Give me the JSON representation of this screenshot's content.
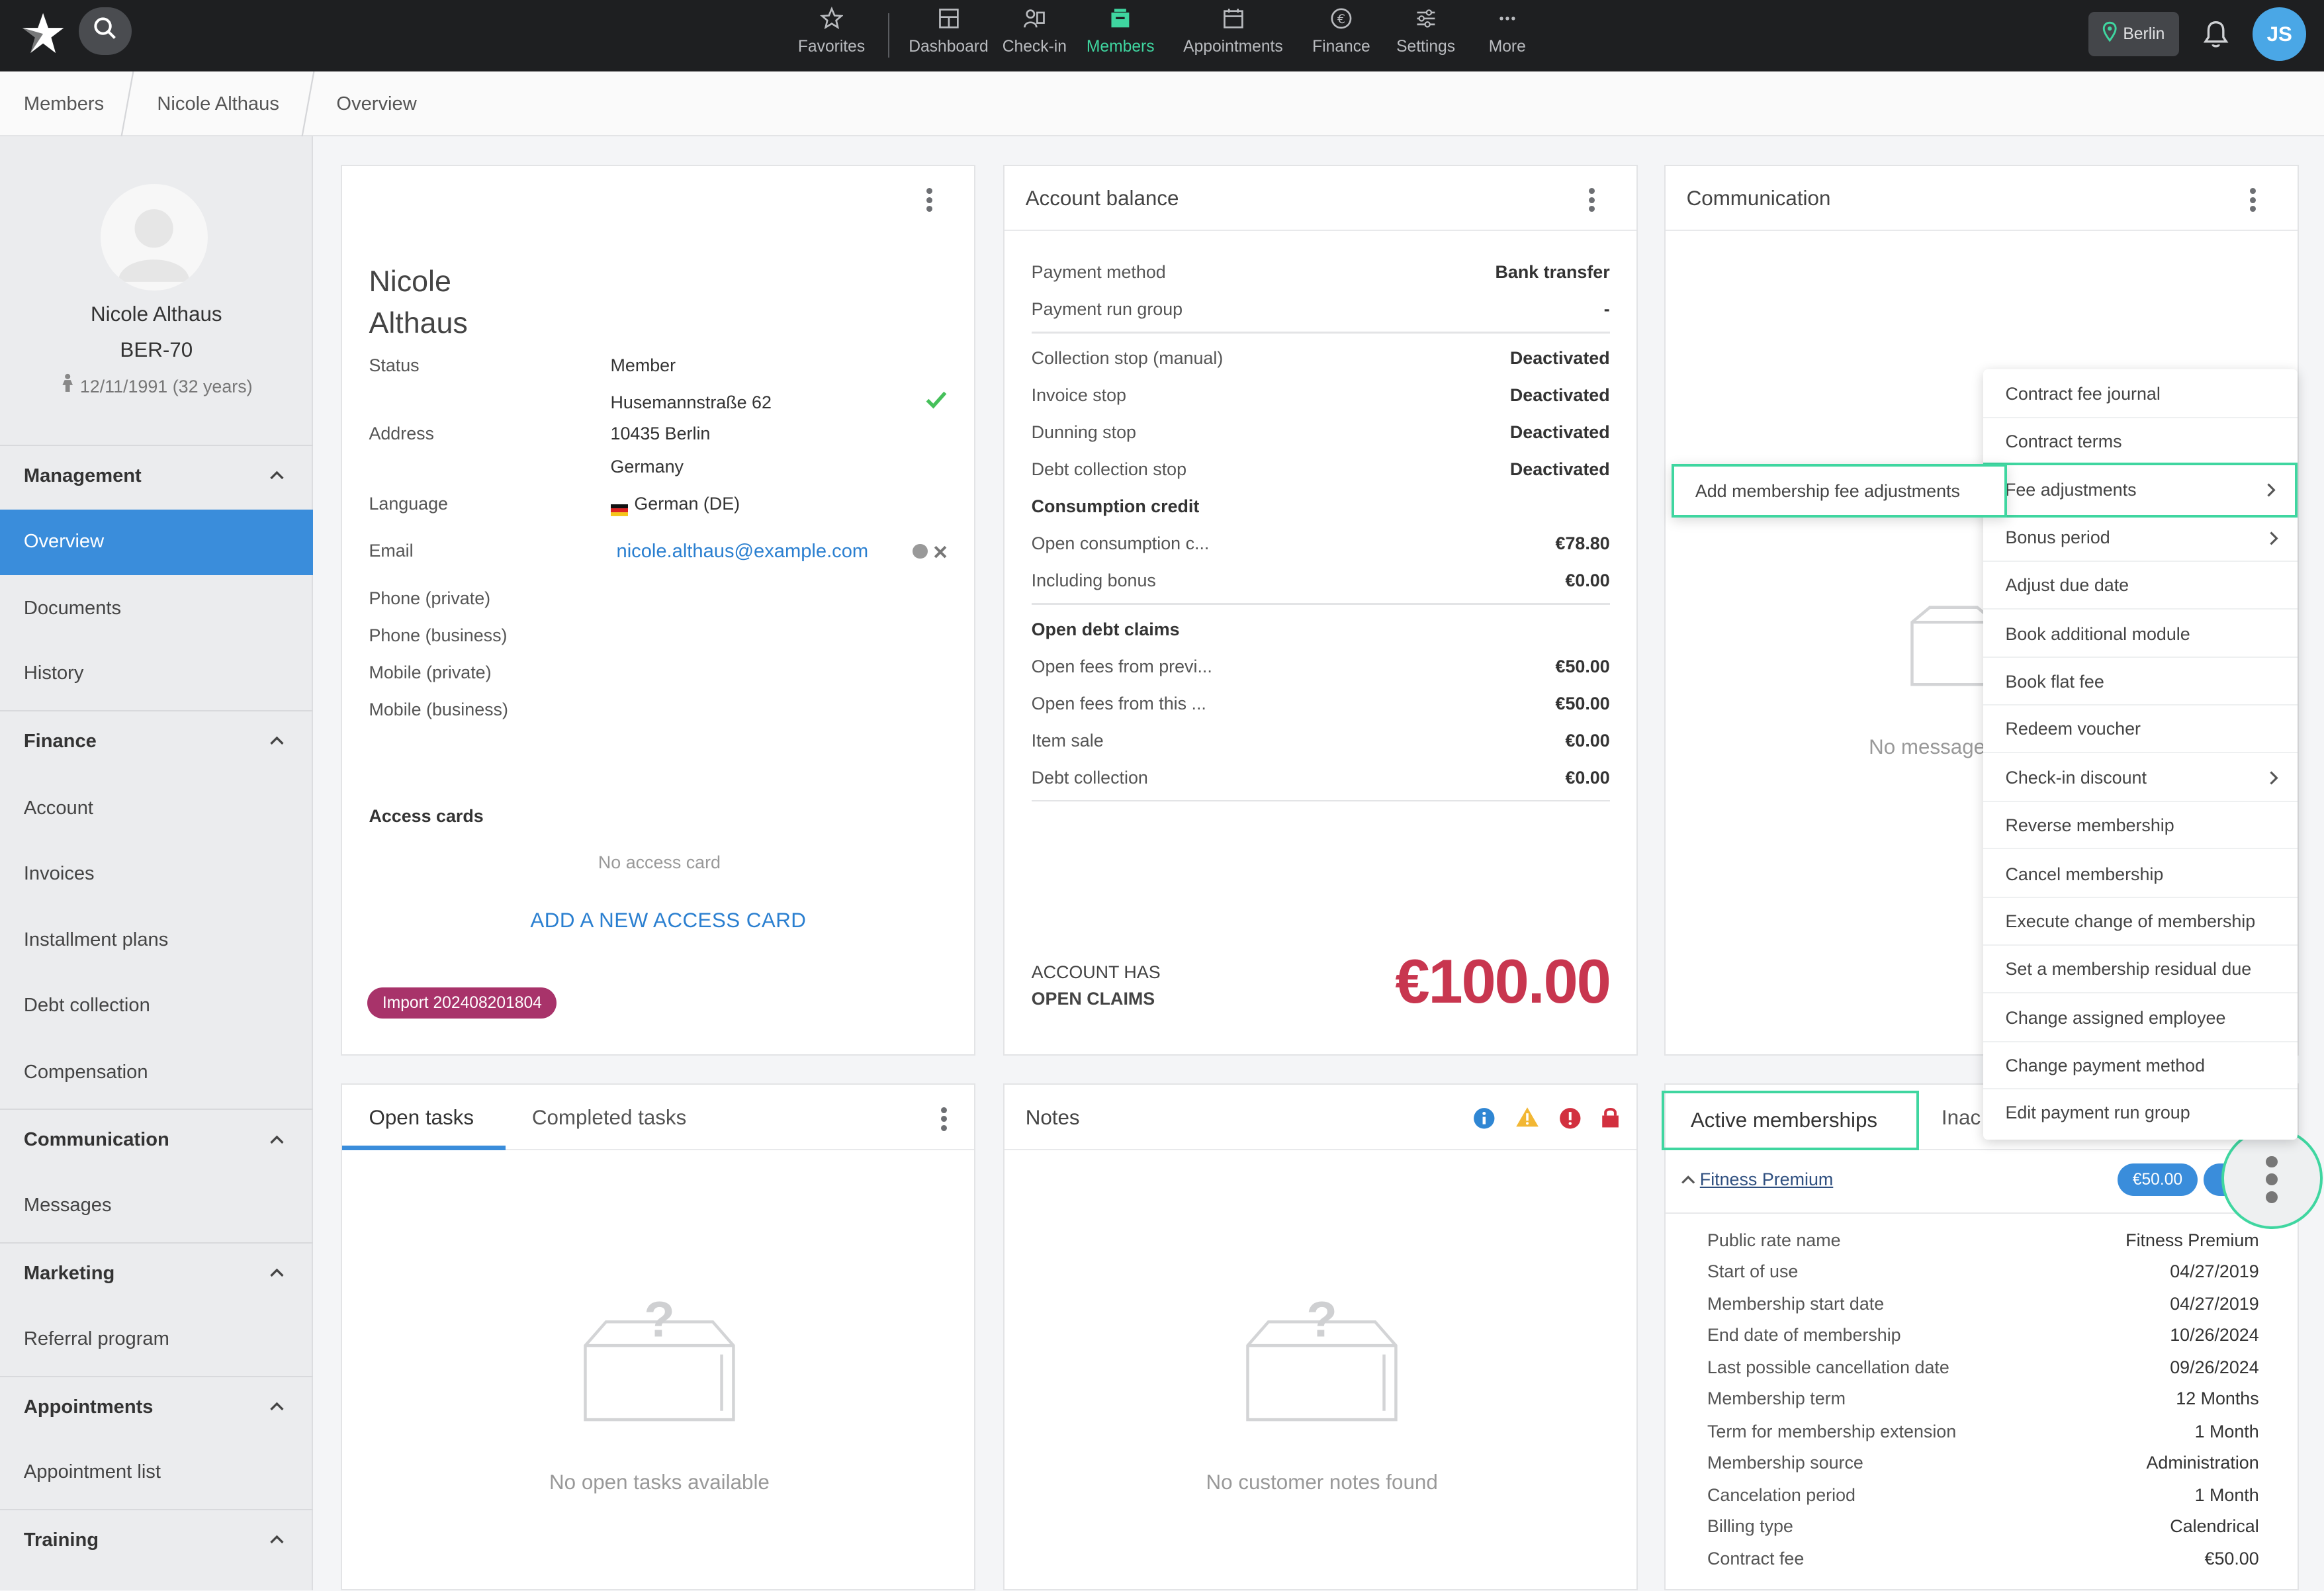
{
  "nav": {
    "items": [
      {
        "label": "Favorites",
        "icon": "star-icon"
      },
      {
        "label": "Dashboard",
        "icon": "dashboard-icon"
      },
      {
        "label": "Check-in",
        "icon": "check-in-icon"
      },
      {
        "label": "Members",
        "icon": "members-icon"
      },
      {
        "label": "Appointments",
        "icon": "calendar-icon"
      },
      {
        "label": "Finance",
        "icon": "euro-icon"
      },
      {
        "label": "Settings",
        "icon": "sliders-icon"
      },
      {
        "label": "More",
        "icon": "more-icon"
      }
    ],
    "active": "Members",
    "location": "Berlin",
    "user_initials": "JS"
  },
  "breadcrumb": [
    "Members",
    "Nicole Althaus",
    "Overview"
  ],
  "profile": {
    "name": "Nicole Althaus",
    "id": "BER-70",
    "dob": "12/11/1991 (32 years)"
  },
  "sidebar": {
    "sections": [
      {
        "label": "Management",
        "items": [
          "Overview",
          "Documents",
          "History"
        ]
      },
      {
        "label": "Finance",
        "items": [
          "Account",
          "Invoices",
          "Installment plans",
          "Debt collection",
          "Compensation"
        ]
      },
      {
        "label": "Communication",
        "items": [
          "Messages"
        ]
      },
      {
        "label": "Marketing",
        "items": [
          "Referral program"
        ]
      },
      {
        "label": "Appointments",
        "items": [
          "Appointment list"
        ]
      },
      {
        "label": "Training",
        "items": []
      }
    ],
    "active": "Overview"
  },
  "member_card": {
    "first_name": "Nicole",
    "last_name": "Althaus",
    "status_label": "Status",
    "status_value": "Member",
    "address_label": "Address",
    "address_line1": "Husemannstraße 62",
    "address_line2": "10435 Berlin",
    "address_line3": "Germany",
    "language_label": "Language",
    "language_value": "German (DE)",
    "email_label": "Email",
    "email_value": "nicole.althaus@example.com",
    "phone_private_label": "Phone (private)",
    "phone_business_label": "Phone (business)",
    "mobile_private_label": "Mobile (private)",
    "mobile_business_label": "Mobile (business)",
    "access_cards_label": "Access cards",
    "no_access_card": "No access card",
    "add_card": "ADD A NEW ACCESS CARD",
    "tag": "Import 202408201804"
  },
  "account_balance": {
    "title": "Account balance",
    "rows": [
      {
        "k": "Payment method",
        "v": "Bank transfer"
      },
      {
        "k": "Payment run group",
        "v": "-"
      },
      {
        "k": "Collection stop (manual)",
        "v": "Deactivated"
      },
      {
        "k": "Invoice stop",
        "v": "Deactivated"
      },
      {
        "k": "Dunning stop",
        "v": "Deactivated"
      },
      {
        "k": "Debt collection stop",
        "v": "Deactivated"
      },
      {
        "k": "Consumption credit",
        "v": ""
      },
      {
        "k": "Open consumption c...",
        "v": "€78.80"
      },
      {
        "k": "Including bonus",
        "v": "€0.00"
      },
      {
        "k": "Open debt claims",
        "v": ""
      },
      {
        "k": "Open fees from previ...",
        "v": "€50.00"
      },
      {
        "k": "Open fees from this ...",
        "v": "€50.00"
      },
      {
        "k": "Item sale",
        "v": "€0.00"
      },
      {
        "k": "Debt collection",
        "v": "€0.00"
      }
    ],
    "claims_line1": "ACCOUNT HAS",
    "claims_line2": "OPEN CLAIMS",
    "claims_amount": "€100.00",
    "claims_color": "#c8364f"
  },
  "communication": {
    "title": "Communication",
    "empty_text": "No message"
  },
  "context_menu": {
    "items": [
      {
        "label": "Contract fee journal",
        "submenu": false
      },
      {
        "label": "Contract terms",
        "submenu": false
      },
      {
        "label": "Fee adjustments",
        "submenu": true
      },
      {
        "label": "Bonus period",
        "submenu": true
      },
      {
        "label": "Adjust due date",
        "submenu": false
      },
      {
        "label": "Book additional module",
        "submenu": false
      },
      {
        "label": "Book flat fee",
        "submenu": false
      },
      {
        "label": "Redeem voucher",
        "submenu": false
      },
      {
        "label": "Check-in discount",
        "submenu": true
      },
      {
        "label": "Reverse membership",
        "submenu": false
      },
      {
        "label": "Cancel membership",
        "submenu": false
      },
      {
        "label": "Execute change of membership",
        "submenu": false
      },
      {
        "label": "Set a membership residual due",
        "submenu": false
      },
      {
        "label": "Change assigned employee",
        "submenu": false
      },
      {
        "label": "Change payment method",
        "submenu": false
      },
      {
        "label": "Edit payment run group",
        "submenu": false
      }
    ],
    "highlighted": "Fee adjustments",
    "submenu_item": "Add membership fee adjustments"
  },
  "tasks": {
    "tab_open": "Open tasks",
    "tab_completed": "Completed tasks",
    "empty_text": "No open tasks available"
  },
  "notes": {
    "title": "Notes",
    "empty_text": "No customer notes found"
  },
  "memberships": {
    "tab_active": "Active memberships",
    "tab_inactive": "Inac",
    "name": "Fitness Premium",
    "fee_pill": "€50.00",
    "rows": [
      {
        "k": "Public rate name",
        "v": "Fitness Premium"
      },
      {
        "k": "Start of use",
        "v": "04/27/2019"
      },
      {
        "k": "Membership start date",
        "v": "04/27/2019"
      },
      {
        "k": "End date of membership",
        "v": "10/26/2024"
      },
      {
        "k": "Last possible cancellation date",
        "v": "09/26/2024"
      },
      {
        "k": "Membership term",
        "v": "12 Months"
      },
      {
        "k": "Term for membership extension",
        "v": "1 Month"
      },
      {
        "k": "Membership source",
        "v": "Administration"
      },
      {
        "k": "Cancelation period",
        "v": "1 Month"
      },
      {
        "k": "Billing type",
        "v": "Calendrical"
      },
      {
        "k": "Contract fee",
        "v": "€50.00"
      }
    ]
  },
  "colors": {
    "accent": "#3fd6a0",
    "primary": "#3a8ddb",
    "topbar": "#1e1f21",
    "danger": "#c8364f"
  }
}
